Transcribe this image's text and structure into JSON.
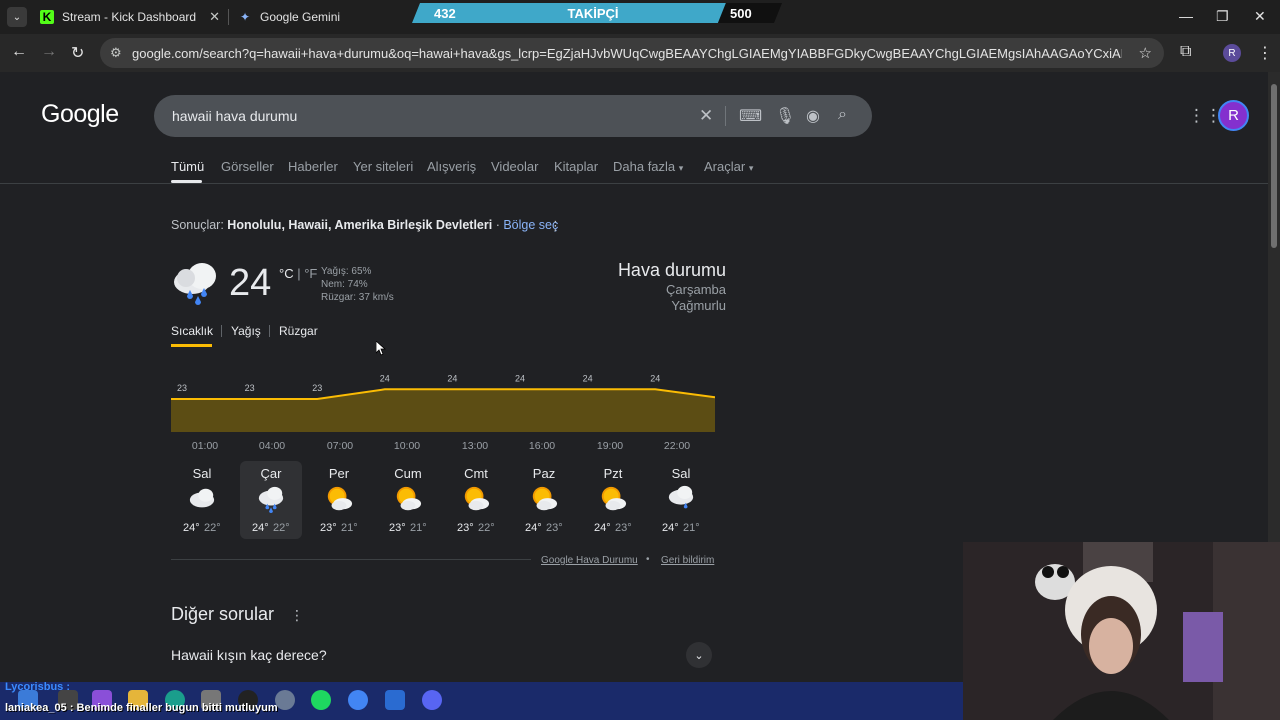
{
  "browser": {
    "tabs": [
      {
        "title": "Stream - Kick Dashboard",
        "favicon": "K"
      },
      {
        "title": "Google Gemini",
        "favicon": "✦"
      }
    ],
    "url": "google.com/search?q=hawaii+hava+durumu&oq=hawai+hava&gs_lcrp=EgZjaHJvbWUqCwgBEAAYChgLGIAEMgYIABBFGDkyCwgBEAAYChgLGIAEMgsIAhAAGAoYCxiABDILCAMQABgKGAsYgA...",
    "profile_initial": "R"
  },
  "overlay": {
    "follower_count": "432",
    "follower_label": "TAKİPÇİ",
    "follower_goal": "500",
    "follower_progress": 0.864,
    "chat_user": "Lycorisbus :",
    "chat_message": "laniakea_05 : Benimde finaller bugun bitti mutluyum"
  },
  "google": {
    "logo": "Google",
    "query": "hawaii hava durumu",
    "profile_initial": "R",
    "tabs": [
      "Tümü",
      "Görseller",
      "Haberler",
      "Yer siteleri",
      "Alışveriş",
      "Videolar",
      "Kitaplar",
      "Daha fazla",
      "Araçlar"
    ]
  },
  "weather": {
    "results_prefix": "Sonuçlar:",
    "location": "Honolulu, Hawaii, Amerika Birleşik Devletleri",
    "separator": "·",
    "region_link": "Bölge seç",
    "temperature": "24",
    "unit_c": "°C",
    "unit_sep": "|",
    "unit_f": "°F",
    "precip": "Yağış: 65%",
    "humidity": "Nem: 74%",
    "wind": "Rüzgar: 37 km/s",
    "title": "Hava durumu",
    "day": "Çarşamba",
    "condition": "Yağmurlu",
    "subtabs": [
      "Sıcaklık",
      "Yağış",
      "Rüzgar"
    ],
    "footer_source": "Google Hava Durumu",
    "footer_dot": "•",
    "footer_feedback": "Geri bildirim",
    "forecast": [
      {
        "day": "Sal",
        "hi": "24°",
        "lo": "22°",
        "icon": "cloudy-icon"
      },
      {
        "day": "Çar",
        "hi": "24°",
        "lo": "22°",
        "icon": "rain-icon"
      },
      {
        "day": "Per",
        "hi": "23°",
        "lo": "21°",
        "icon": "partly-cloudy-icon"
      },
      {
        "day": "Cum",
        "hi": "23°",
        "lo": "21°",
        "icon": "partly-cloudy-icon"
      },
      {
        "day": "Cmt",
        "hi": "23°",
        "lo": "22°",
        "icon": "partly-cloudy-icon"
      },
      {
        "day": "Paz",
        "hi": "24°",
        "lo": "23°",
        "icon": "partly-cloudy-icon"
      },
      {
        "day": "Pzt",
        "hi": "24°",
        "lo": "23°",
        "icon": "partly-cloudy-icon"
      },
      {
        "day": "Sal",
        "hi": "24°",
        "lo": "21°",
        "icon": "showers-icon"
      }
    ]
  },
  "chart_data": {
    "type": "area",
    "x": [
      "01:00",
      "04:00",
      "07:00",
      "10:00",
      "13:00",
      "16:00",
      "19:00",
      "22:00"
    ],
    "values": [
      23,
      23,
      23,
      24,
      24,
      24,
      24,
      24
    ],
    "ylim": [
      20,
      26
    ],
    "color": "#fbbc04"
  },
  "people_also_ask": {
    "title": "Diğer sorular",
    "questions": [
      "Hawaii kışın kaç derece?"
    ]
  }
}
